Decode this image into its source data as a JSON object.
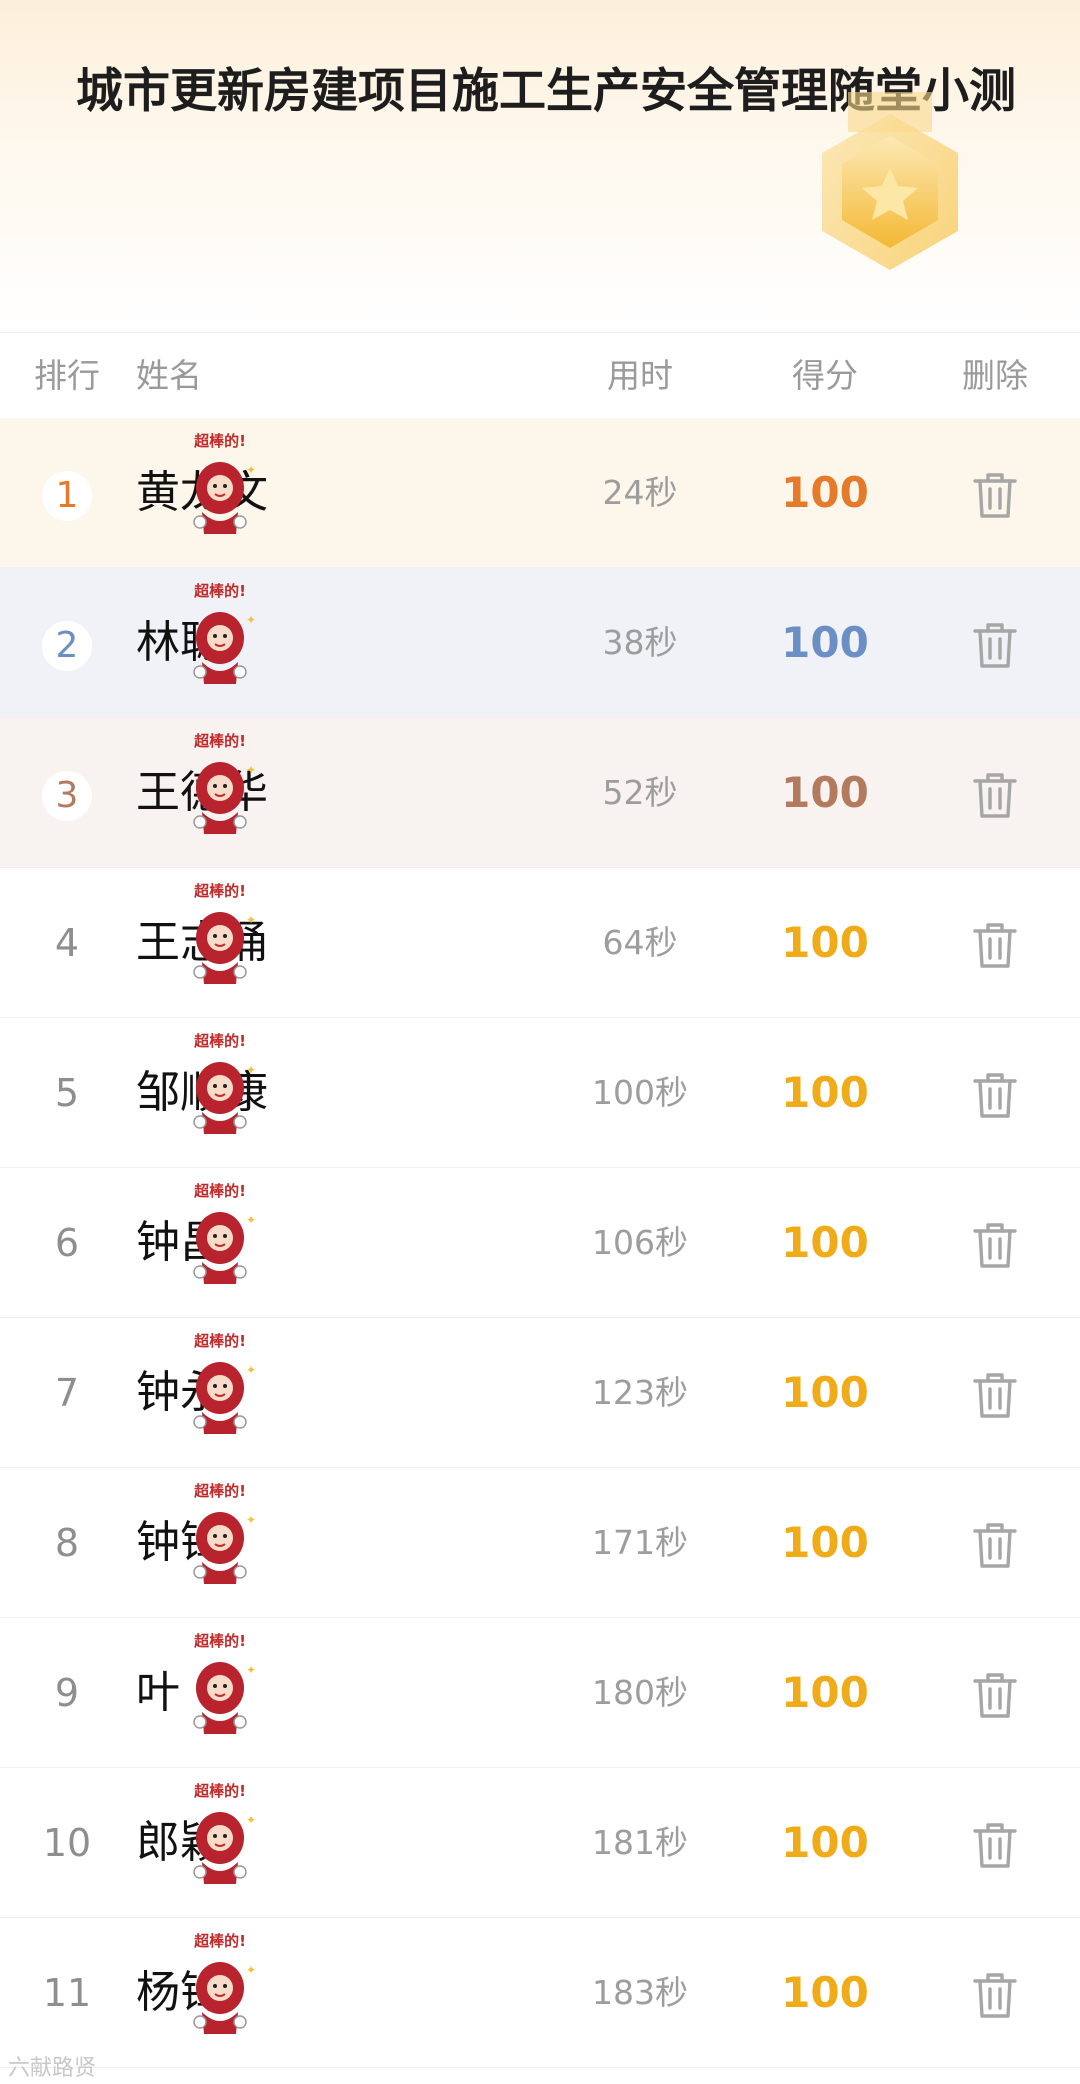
{
  "page": {
    "title": "城市更新房建项目施工生产安全管理随堂小测"
  },
  "table": {
    "headers": {
      "rank": "排行",
      "name": "姓名",
      "time": "用时",
      "score": "得分",
      "delete": "删除"
    },
    "sticker_text": "超棒的!",
    "rows": [
      {
        "rank": "1",
        "name": "黄龙文",
        "time": "24秒",
        "score": "100"
      },
      {
        "rank": "2",
        "name": "林聪",
        "time": "38秒",
        "score": "100"
      },
      {
        "rank": "3",
        "name": "王德华",
        "time": "52秒",
        "score": "100"
      },
      {
        "rank": "4",
        "name": "王志涌",
        "time": "64秒",
        "score": "100"
      },
      {
        "rank": "5",
        "name": "邹顺康",
        "time": "100秒",
        "score": "100"
      },
      {
        "rank": "6",
        "name": "钟昌",
        "time": "106秒",
        "score": "100"
      },
      {
        "rank": "7",
        "name": "钟永",
        "time": "123秒",
        "score": "100"
      },
      {
        "rank": "8",
        "name": "钟锋",
        "time": "171秒",
        "score": "100"
      },
      {
        "rank": "9",
        "name": "叶",
        "time": "180秒",
        "score": "100"
      },
      {
        "rank": "10",
        "name": "郎颖",
        "time": "181秒",
        "score": "100"
      },
      {
        "rank": "11",
        "name": "杨锋",
        "time": "183秒",
        "score": "100"
      }
    ]
  },
  "watermark": "六献路贤",
  "colors": {
    "gold": "#f0ac18",
    "first": "#e57a2a",
    "second": "#6b8fc4",
    "third": "#b37a5e",
    "muted": "#9a9a9a"
  },
  "icons": {
    "badge": "star-badge-icon",
    "delete": "trash-icon"
  }
}
